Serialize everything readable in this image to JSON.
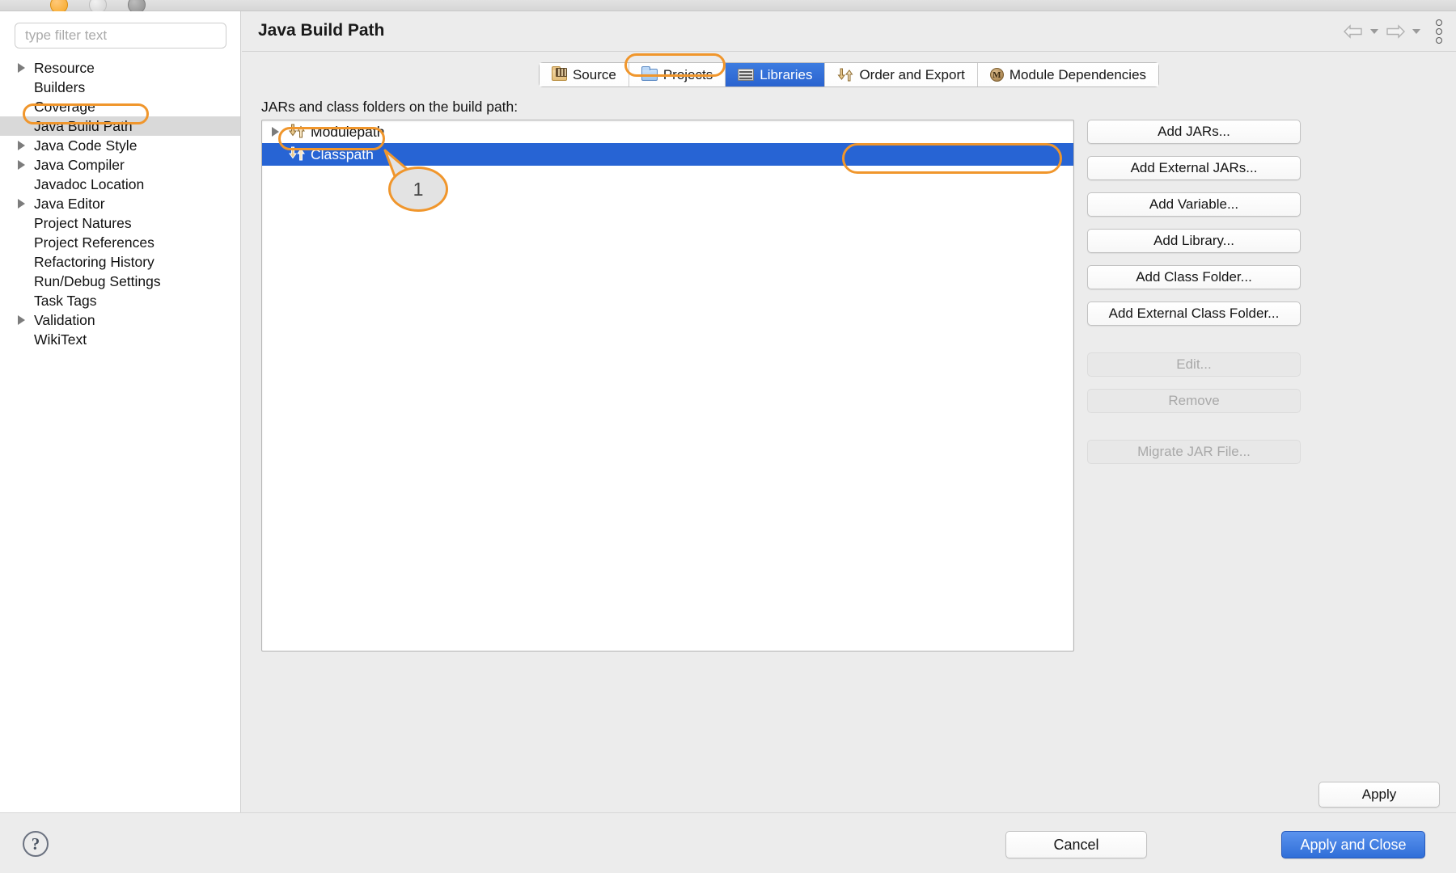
{
  "window": {
    "traffic_lights": [
      "close-button",
      "minimize-button",
      "zoom-button"
    ]
  },
  "sidebar": {
    "filter": {
      "placeholder": "type filter text",
      "value": ""
    },
    "items": [
      {
        "label": "Resource",
        "expandable": true,
        "selected": false
      },
      {
        "label": "Builders",
        "expandable": false,
        "selected": false
      },
      {
        "label": "Coverage",
        "expandable": false,
        "selected": false
      },
      {
        "label": "Java Build Path",
        "expandable": false,
        "selected": true
      },
      {
        "label": "Java Code Style",
        "expandable": true,
        "selected": false
      },
      {
        "label": "Java Compiler",
        "expandable": true,
        "selected": false
      },
      {
        "label": "Javadoc Location",
        "expandable": false,
        "selected": false
      },
      {
        "label": "Java Editor",
        "expandable": true,
        "selected": false
      },
      {
        "label": "Project Natures",
        "expandable": false,
        "selected": false
      },
      {
        "label": "Project References",
        "expandable": false,
        "selected": false
      },
      {
        "label": "Refactoring History",
        "expandable": false,
        "selected": false
      },
      {
        "label": "Run/Debug Settings",
        "expandable": false,
        "selected": false
      },
      {
        "label": "Task Tags",
        "expandable": false,
        "selected": false
      },
      {
        "label": "Validation",
        "expandable": true,
        "selected": false
      },
      {
        "label": "WikiText",
        "expandable": false,
        "selected": false
      }
    ]
  },
  "header": {
    "title": "Java Build Path",
    "nav": {
      "back_label": "Back",
      "forward_label": "Forward",
      "menu_label": "View Menu"
    }
  },
  "tabs": [
    {
      "label": "Source",
      "icon": "source-folder-icon",
      "active": false
    },
    {
      "label": "Projects",
      "icon": "projects-folder-icon",
      "active": false
    },
    {
      "label": "Libraries",
      "icon": "libraries-icon",
      "active": true
    },
    {
      "label": "Order and Export",
      "icon": "order-export-arrows-icon",
      "active": false
    },
    {
      "label": "Module Dependencies",
      "icon": "module-badge-icon",
      "active": false
    }
  ],
  "main": {
    "panel_label": "JARs and class folders on the build path:",
    "tree_items": [
      {
        "label": "Modulepath",
        "expandable": true,
        "selected": false,
        "icon": "path-arrows-icon"
      },
      {
        "label": "Classpath",
        "expandable": false,
        "selected": true,
        "icon": "path-arrows-icon"
      }
    ]
  },
  "side_buttons": [
    {
      "label": "Add JARs...",
      "enabled": true,
      "group": 1
    },
    {
      "label": "Add External JARs...",
      "enabled": true,
      "group": 1
    },
    {
      "label": "Add Variable...",
      "enabled": true,
      "group": 1
    },
    {
      "label": "Add Library...",
      "enabled": true,
      "group": 1
    },
    {
      "label": "Add Class Folder...",
      "enabled": true,
      "group": 1
    },
    {
      "label": "Add External Class Folder...",
      "enabled": true,
      "group": 1
    },
    {
      "label": "Edit...",
      "enabled": false,
      "group": 2
    },
    {
      "label": "Remove",
      "enabled": false,
      "group": 2
    },
    {
      "label": "Migrate JAR File...",
      "enabled": false,
      "group": 3
    }
  ],
  "footer": {
    "apply_label": "Apply",
    "help_label": "?",
    "cancel_label": "Cancel",
    "apply_and_close_label": "Apply and Close"
  },
  "annotations": [
    {
      "id": "ring-sidebar",
      "target": "Java Build Path",
      "shape": "rounded-rect-ring"
    },
    {
      "id": "ring-tab",
      "target": "Libraries",
      "shape": "rounded-rect-ring"
    },
    {
      "id": "ring-classpath",
      "target": "Classpath",
      "shape": "rounded-rect-ring"
    },
    {
      "id": "ring-addext",
      "target": "Add External JARs...",
      "shape": "rounded-rect-ring"
    },
    {
      "id": "callout-1",
      "number": "1",
      "shape": "circle-callout"
    }
  ],
  "colors": {
    "annotation_orange": "#f0962c",
    "selection_blue": "#2764d4",
    "primary_button_blue": "#2f6ed8",
    "sidebar_selection_gray": "#d9d9d9",
    "window_background": "#ececec"
  }
}
